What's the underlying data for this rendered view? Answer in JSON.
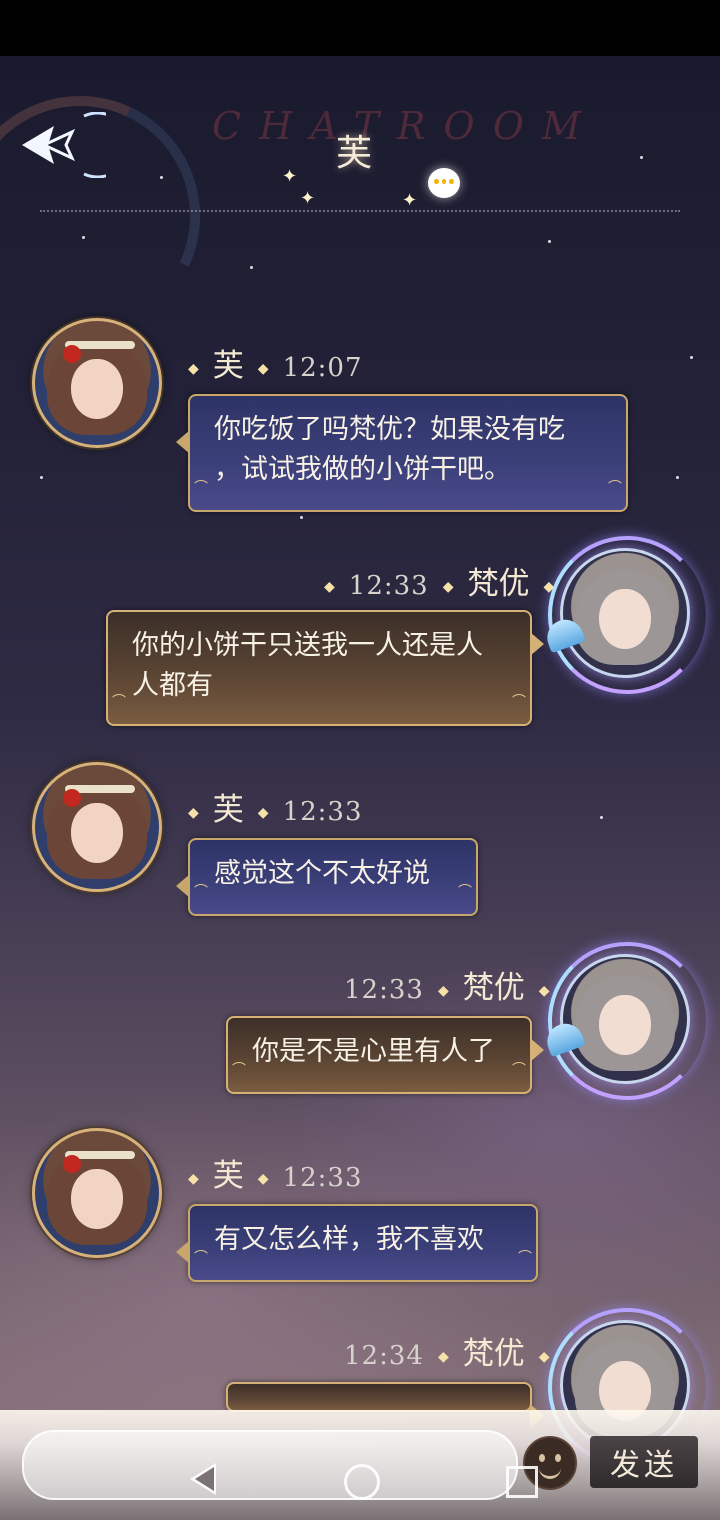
{
  "header": {
    "watermark": "CHATROOM",
    "title": "芙",
    "back_icon": "back-arrow-icon",
    "chat_icon": "chat-bubble-icon"
  },
  "messages": [
    {
      "side": "left",
      "name": "芙",
      "time": "12:07",
      "lines": [
        "你吃饭了吗梵优？如果没有吃",
        "，试试我做的小饼干吧。"
      ]
    },
    {
      "side": "right",
      "name": "梵优",
      "time": "12:33",
      "lines": [
        "你的小饼干只送我一人还是人",
        "人都有"
      ]
    },
    {
      "side": "left",
      "name": "芙",
      "time": "12:33",
      "lines": [
        "感觉这个不太好说"
      ]
    },
    {
      "side": "right",
      "name": "梵优",
      "time": "12:33",
      "lines": [
        "你是不是心里有人了"
      ]
    },
    {
      "side": "left",
      "name": "芙",
      "time": "12:33",
      "lines": [
        "有又怎么样，我不喜欢"
      ]
    },
    {
      "side": "right",
      "name": "梵优",
      "time": "12:34",
      "lines": []
    }
  ],
  "input_bar": {
    "placeholder": "",
    "emoji_icon": "emoji-face-icon",
    "send_label": "发送"
  },
  "nav": {
    "back_icon": "triangle-back-icon",
    "home_icon": "circle-home-icon",
    "recent_icon": "square-recent-icon"
  },
  "colors": {
    "left_bubble": "#3a3f78",
    "right_bubble": "#5a4433",
    "bubble_border": "#c9a76a"
  }
}
